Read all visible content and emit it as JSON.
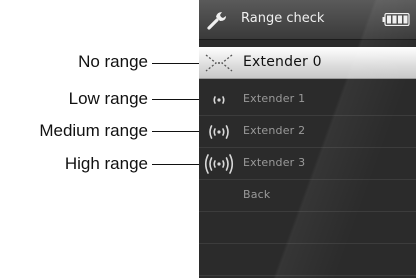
{
  "callouts": {
    "no_range": "No range",
    "low_range": "Low range",
    "medium_range": "Medium range",
    "high_range": "High range"
  },
  "screen": {
    "title": "Range check",
    "title_icon": "wrench-icon",
    "battery_icon": "battery-icon",
    "items": [
      {
        "label": "Extender 0",
        "icon": "no-signal-icon",
        "selected": true
      },
      {
        "label": "Extender 1",
        "icon": "signal-low-icon",
        "selected": false
      },
      {
        "label": "Extender 2",
        "icon": "signal-medium-icon",
        "selected": false
      },
      {
        "label": "Extender 3",
        "icon": "signal-high-icon",
        "selected": false
      },
      {
        "label": "Back",
        "icon": "",
        "selected": false
      }
    ]
  }
}
